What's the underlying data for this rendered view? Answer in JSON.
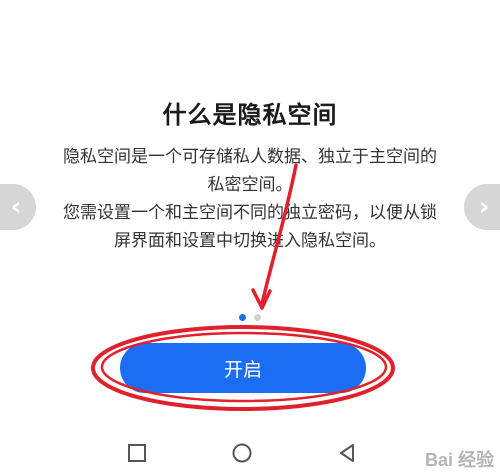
{
  "intro": {
    "title": "什么是隐私空间",
    "desc_lines": [
      "隐私空间是一个可存储私人数据、独立于主空间的",
      "私密空间。",
      "您需设置一个和主空间不同的独立密码，以便从锁",
      "屏界面和设置中切换进入隐私空间。"
    ]
  },
  "carousel": {
    "prev_icon": "chevron-left-icon",
    "prev_glyph": "‹",
    "next_icon": "chevron-right-icon",
    "next_glyph": "›",
    "page_count": 2,
    "active_page": 1
  },
  "actions": {
    "open_label": "开启"
  },
  "navbar": {
    "recent_icon": "square-icon",
    "home_icon": "circle-icon",
    "back_icon": "triangle-back-icon"
  },
  "watermark": {
    "text": "Bai 经验"
  },
  "colors": {
    "accent": "#1b6ef3",
    "annotation": "#e0202a"
  }
}
